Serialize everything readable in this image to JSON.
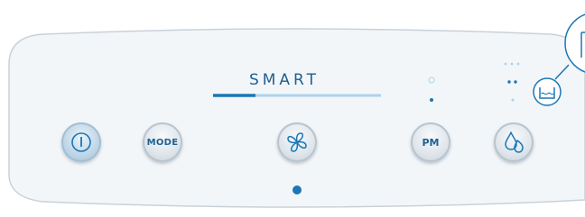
{
  "panel": {
    "mode_label": "SMART",
    "colors": {
      "accent": "#1b77b6",
      "light_accent": "#a9d3ee",
      "panel_fill": "#f3f6f8",
      "panel_border": "#c9d1d8",
      "text": "#1f5f8f"
    }
  },
  "buttons": {
    "power": {
      "icon": "power-icon"
    },
    "mode": {
      "label": "MODE"
    },
    "fan": {
      "icon": "fan-icon"
    },
    "pm": {
      "label": "PM"
    },
    "humidity": {
      "icon": "water-drops-icon"
    }
  },
  "indicators": {
    "tank_icon": "water-tank-icon",
    "callout_icon": "zoom-callout-icon"
  }
}
